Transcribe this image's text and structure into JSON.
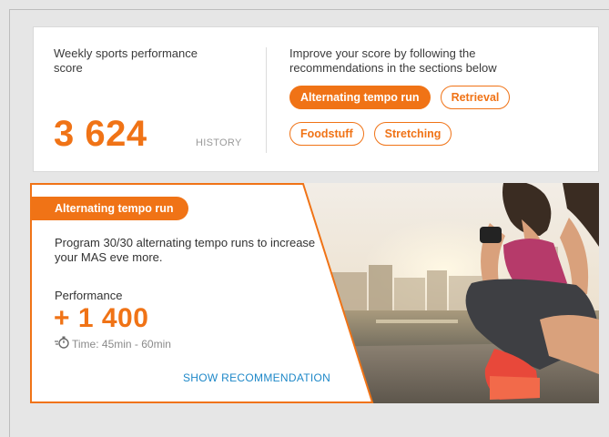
{
  "score_card": {
    "title": "Weekly sports performance score",
    "score": "3 624",
    "history_label": "HISTORY",
    "improve_text": "Improve your score by following the recommendations in the sections below",
    "chips_row1": [
      "Alternating tempo run",
      "Retrieval"
    ],
    "chips_row2": [
      "Foodstuff",
      "Stretching"
    ]
  },
  "recommendation": {
    "badge": "Alternating tempo run",
    "description": "Program 30/30 alternating tempo runs to increase your MAS eve more.",
    "performance_label": "Performance",
    "performance_value": "+ 1 400",
    "time_text": "Time: 45min - 60min",
    "time_icon": "stopwatch-icon",
    "show_label": "SHOW RECOMMENDATION"
  },
  "colors": {
    "accent": "#f07316",
    "link": "#1e88c8",
    "background": "#e6e6e6"
  }
}
